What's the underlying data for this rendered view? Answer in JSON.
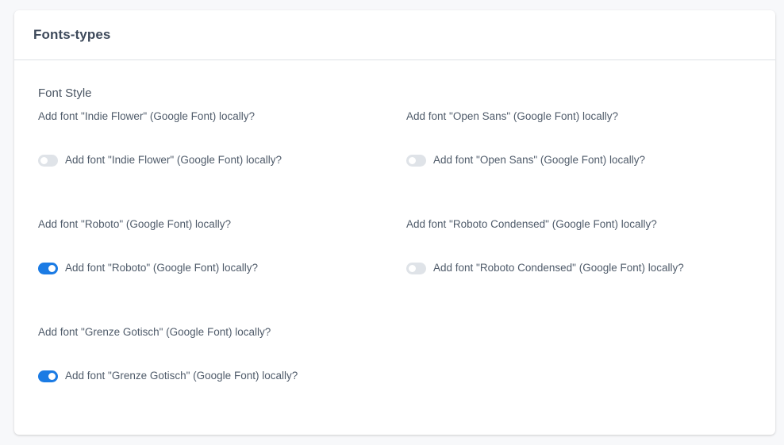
{
  "card": {
    "title": "Fonts-types"
  },
  "section": {
    "title": "Font Style"
  },
  "fonts": [
    {
      "label": "Add font \"Indie Flower\" (Google Font) locally?",
      "toggle_label": "Add font \"Indie Flower\" (Google Font) locally?",
      "enabled": false
    },
    {
      "label": "Add font \"Open Sans\" (Google Font) locally?",
      "toggle_label": "Add font \"Open Sans\" (Google Font) locally?",
      "enabled": false
    },
    {
      "label": "Add font \"Roboto\" (Google Font) locally?",
      "toggle_label": "Add font \"Roboto\" (Google Font) locally?",
      "enabled": true
    },
    {
      "label": "Add font \"Roboto Condensed\" (Google Font) locally?",
      "toggle_label": "Add font \"Roboto Condensed\" (Google Font) locally?",
      "enabled": false
    },
    {
      "label": "Add font \"Grenze Gotisch\" (Google Font) locally?",
      "toggle_label": "Add font \"Grenze Gotisch\" (Google Font) locally?",
      "enabled": true
    }
  ],
  "colors": {
    "accent": "#1b7be4",
    "toggle_off": "#dfe3e8"
  }
}
